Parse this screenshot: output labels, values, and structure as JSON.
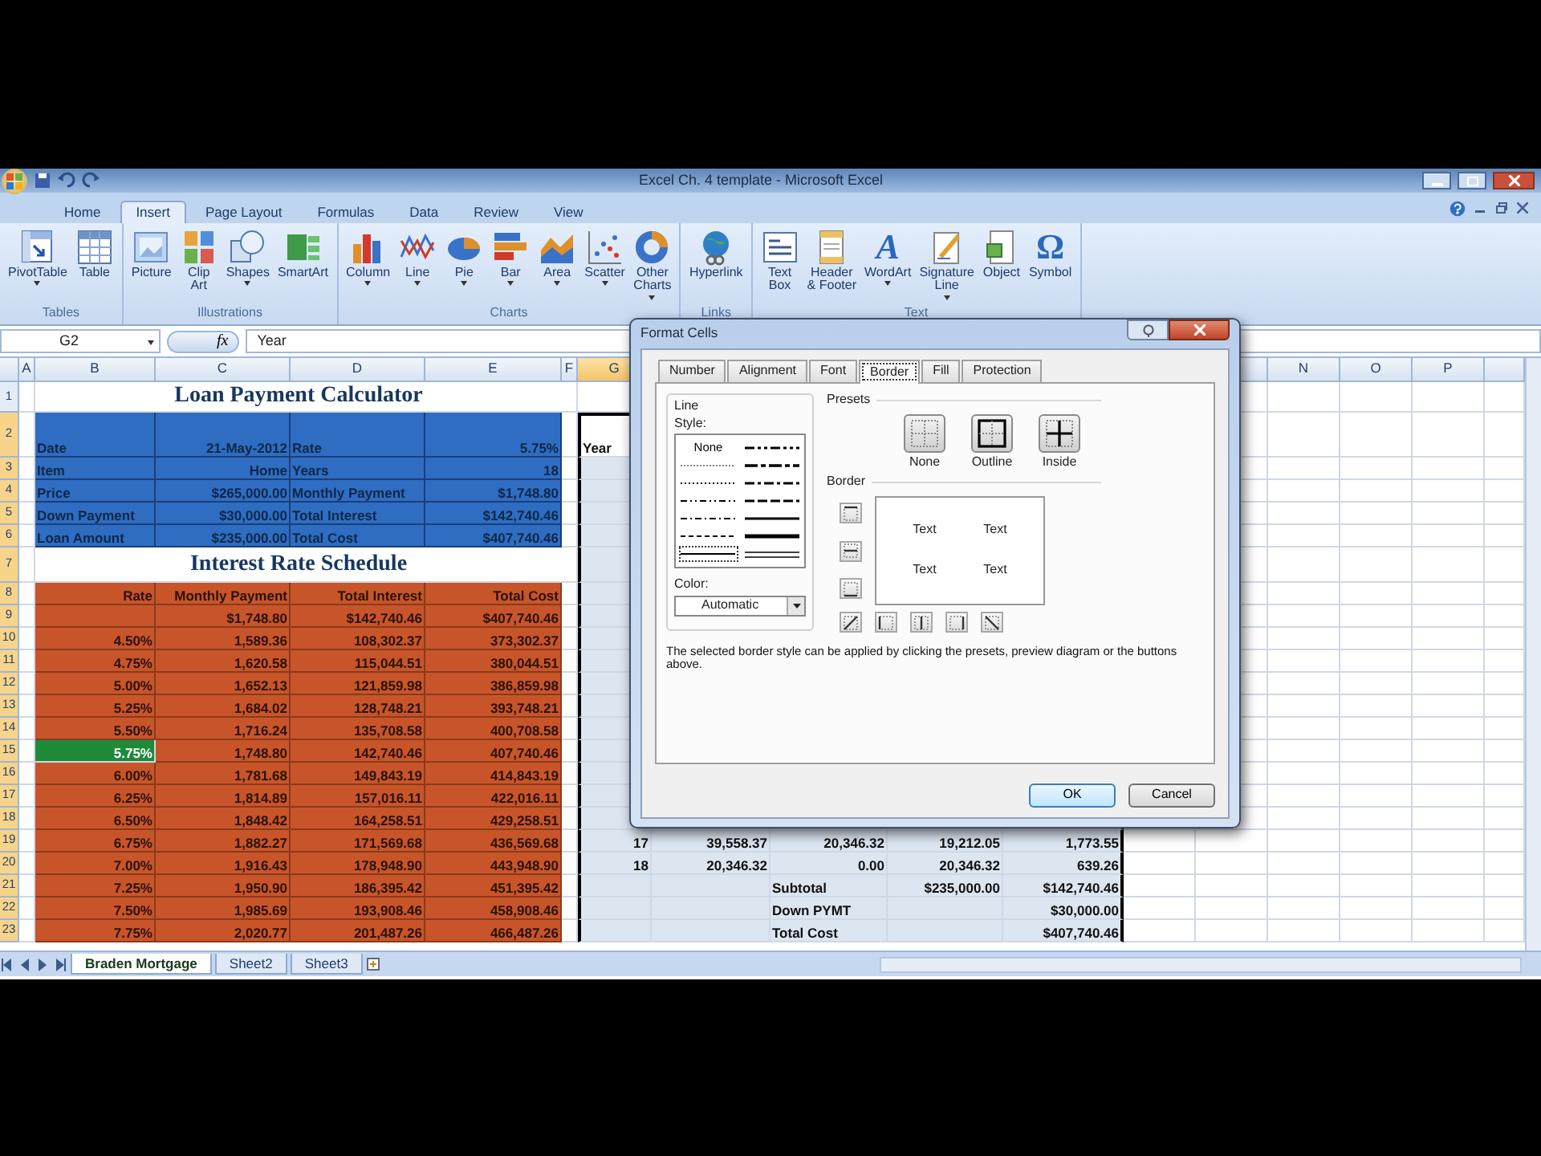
{
  "window": {
    "title": "Excel Ch. 4 template - Microsoft Excel"
  },
  "ribbon_tabs": [
    {
      "label": "Home",
      "selected": false
    },
    {
      "label": "Insert",
      "selected": true
    },
    {
      "label": "Page Layout",
      "selected": false
    },
    {
      "label": "Formulas",
      "selected": false
    },
    {
      "label": "Data",
      "selected": false
    },
    {
      "label": "Review",
      "selected": false
    },
    {
      "label": "View",
      "selected": false
    }
  ],
  "ribbon_groups": [
    {
      "label": "Tables",
      "buttons": [
        {
          "kind": "pivottable",
          "label": "PivotTable",
          "dropdown": true
        },
        {
          "kind": "table",
          "label": "Table",
          "dropdown": false
        }
      ]
    },
    {
      "label": "Illustrations",
      "buttons": [
        {
          "kind": "picture",
          "label": "Picture",
          "dropdown": false
        },
        {
          "kind": "clipart",
          "label": "Clip\nArt",
          "dropdown": false
        },
        {
          "kind": "shapes",
          "label": "Shapes",
          "dropdown": true
        },
        {
          "kind": "smartart",
          "label": "SmartArt",
          "dropdown": false
        }
      ]
    },
    {
      "label": "Charts",
      "buttons": [
        {
          "kind": "column",
          "label": "Column",
          "dropdown": true
        },
        {
          "kind": "line",
          "label": "Line",
          "dropdown": true
        },
        {
          "kind": "pie",
          "label": "Pie",
          "dropdown": true
        },
        {
          "kind": "bar",
          "label": "Bar",
          "dropdown": true
        },
        {
          "kind": "area",
          "label": "Area",
          "dropdown": true
        },
        {
          "kind": "scatter",
          "label": "Scatter",
          "dropdown": true
        },
        {
          "kind": "other-charts",
          "label": "Other\nCharts",
          "dropdown": true
        }
      ]
    },
    {
      "label": "Links",
      "buttons": [
        {
          "kind": "hyperlink",
          "label": "Hyperlink",
          "dropdown": false
        }
      ]
    },
    {
      "label": "Text",
      "buttons": [
        {
          "kind": "textbox",
          "label": "Text\nBox",
          "dropdown": false
        },
        {
          "kind": "header-footer",
          "label": "Header\n& Footer",
          "dropdown": false
        },
        {
          "kind": "wordart",
          "glyph": "A",
          "label": "WordArt",
          "dropdown": true
        },
        {
          "kind": "signature",
          "label": "Signature\nLine",
          "dropdown": true
        },
        {
          "kind": "object",
          "label": "Object",
          "dropdown": false
        },
        {
          "kind": "symbol",
          "glyph": "Ω",
          "label": "Symbol",
          "dropdown": false
        }
      ]
    }
  ],
  "formula_bar": {
    "name_box": "G2",
    "function_label": "fx",
    "formula": "Year"
  },
  "column_headers_left": [
    {
      "label": "A",
      "selected": false
    },
    {
      "label": "B",
      "selected": false
    },
    {
      "label": "C",
      "selected": false
    },
    {
      "label": "D",
      "selected": false
    },
    {
      "label": "E",
      "selected": false
    },
    {
      "label": "F",
      "selected": false
    },
    {
      "label": "G",
      "selected": true
    }
  ],
  "column_headers_right": [
    {
      "label": "N",
      "selected": false
    },
    {
      "label": "O",
      "selected": false
    },
    {
      "label": "P",
      "selected": false
    }
  ],
  "row_headers": [
    {
      "label": "1",
      "selected": false
    },
    {
      "label": "2",
      "selected": true
    },
    {
      "label": "3",
      "selected": true
    },
    {
      "label": "4",
      "selected": true
    },
    {
      "label": "5",
      "selected": true
    },
    {
      "label": "6",
      "selected": true
    },
    {
      "label": "7",
      "selected": true
    },
    {
      "label": "8",
      "selected": true
    },
    {
      "label": "9",
      "selected": true
    },
    {
      "label": "10",
      "selected": true
    },
    {
      "label": "11",
      "selected": true
    },
    {
      "label": "12",
      "selected": true
    },
    {
      "label": "13",
      "selected": true
    },
    {
      "label": "14",
      "selected": true
    },
    {
      "label": "15",
      "selected": true
    },
    {
      "label": "16",
      "selected": true
    },
    {
      "label": "17",
      "selected": true
    },
    {
      "label": "18",
      "selected": true
    },
    {
      "label": "19",
      "selected": true
    },
    {
      "label": "20",
      "selected": true
    },
    {
      "label": "21",
      "selected": true
    },
    {
      "label": "22",
      "selected": true
    },
    {
      "label": "23",
      "selected": true
    }
  ],
  "loan_calculator": {
    "title": "Loan Payment Calculator",
    "rows": [
      {
        "label": "Date",
        "value": "21-May-2012",
        "label_2": "Rate",
        "value_2": "5.75%"
      },
      {
        "label": "Item",
        "value": "Home",
        "label_2": "Years",
        "value_2": "18"
      },
      {
        "label": "Price",
        "value": "$265,000.00",
        "label_2": "Monthly Payment",
        "value_2": "$1,748.80"
      },
      {
        "label": "Down Payment",
        "value": "$30,000.00",
        "label_2": "Total Interest",
        "value_2": "$142,740.46"
      },
      {
        "label": "Loan Amount",
        "value": "$235,000.00",
        "label_2": "Total Cost",
        "value_2": "$407,740.46"
      }
    ]
  },
  "rate_schedule": {
    "title": "Interest Rate Schedule",
    "columns": [
      "Rate",
      "Monthly Payment",
      "Total Interest",
      "Total Cost"
    ],
    "rows": [
      {
        "cells": [
          null,
          "$1,748.80",
          "$142,740.46",
          "$407,740.46"
        ],
        "highlighted": false
      },
      {
        "cells": [
          "4.50%",
          "1,589.36",
          "108,302.37",
          "373,302.37"
        ],
        "highlighted": false
      },
      {
        "cells": [
          "4.75%",
          "1,620.58",
          "115,044.51",
          "380,044.51"
        ],
        "highlighted": false
      },
      {
        "cells": [
          "5.00%",
          "1,652.13",
          "121,859.98",
          "386,859.98"
        ],
        "highlighted": false
      },
      {
        "cells": [
          "5.25%",
          "1,684.02",
          "128,748.21",
          "393,748.21"
        ],
        "highlighted": false
      },
      {
        "cells": [
          "5.50%",
          "1,716.24",
          "135,708.58",
          "400,708.58"
        ],
        "highlighted": false
      },
      {
        "cells": [
          "5.75%",
          "1,748.80",
          "142,740.46",
          "407,740.46"
        ],
        "highlighted": true
      },
      {
        "cells": [
          "6.00%",
          "1,781.68",
          "149,843.19",
          "414,843.19"
        ],
        "highlighted": false
      },
      {
        "cells": [
          "6.25%",
          "1,814.89",
          "157,016.11",
          "422,016.11"
        ],
        "highlighted": false
      },
      {
        "cells": [
          "6.50%",
          "1,848.42",
          "164,258.51",
          "429,258.51"
        ],
        "highlighted": false
      },
      {
        "cells": [
          "6.75%",
          "1,882.27",
          "171,569.68",
          "436,569.68"
        ],
        "highlighted": false
      },
      {
        "cells": [
          "7.00%",
          "1,916.43",
          "178,948.90",
          "443,948.90"
        ],
        "highlighted": false
      },
      {
        "cells": [
          "7.25%",
          "1,950.90",
          "186,395.42",
          "451,395.42"
        ],
        "highlighted": false
      },
      {
        "cells": [
          "7.50%",
          "1,985.69",
          "193,908.46",
          "458,908.46"
        ],
        "highlighted": false
      },
      {
        "cells": [
          "7.75%",
          "2,020.77",
          "201,487.26",
          "466,487.26"
        ],
        "highlighted": false
      }
    ]
  },
  "year_table": {
    "header": "Year",
    "rows": [
      {
        "cells": [
          "17",
          "39,558.37",
          "20,346.32",
          "19,212.05",
          "1,773.55"
        ]
      },
      {
        "cells": [
          "18",
          "20,346.32",
          "0.00",
          "20,346.32",
          "639.26"
        ]
      }
    ],
    "summary": [
      {
        "label": "Subtotal",
        "column_4": "$235,000.00",
        "column_5": "$142,740.46"
      },
      {
        "label": "Down PYMT",
        "column_5": "$30,000.00"
      },
      {
        "label": "Total Cost",
        "column_5": "$407,740.46"
      }
    ]
  },
  "dialog": {
    "title": "Format Cells",
    "tabs": [
      {
        "label": "Number",
        "selected": false
      },
      {
        "label": "Alignment",
        "selected": false
      },
      {
        "label": "Font",
        "selected": false
      },
      {
        "label": "Border",
        "selected": true
      },
      {
        "label": "Fill",
        "selected": false
      },
      {
        "label": "Protection",
        "selected": false
      }
    ],
    "line": {
      "legend": "Line",
      "style_label": "Style:",
      "styles": [
        {
          "kind": "none",
          "label": "None",
          "selected": false
        },
        {
          "kind": "mdashdotdot",
          "selected": false
        },
        {
          "kind": "hair",
          "selected": false
        },
        {
          "kind": "slantdashdot",
          "selected": false
        },
        {
          "kind": "dotted",
          "selected": false
        },
        {
          "kind": "mdashdot",
          "selected": false
        },
        {
          "kind": "dashdotdot",
          "selected": false
        },
        {
          "kind": "mdashed",
          "selected": false
        },
        {
          "kind": "dashdot",
          "selected": false
        },
        {
          "kind": "medium",
          "selected": false
        },
        {
          "kind": "dashed",
          "selected": false
        },
        {
          "kind": "thick",
          "selected": false
        },
        {
          "kind": "thin",
          "selected": true
        },
        {
          "kind": "double",
          "selected": false
        }
      ],
      "color_label": "Color:",
      "color_value": "Automatic"
    },
    "presets": {
      "legend": "Presets",
      "items": [
        {
          "kind": "none",
          "label": "None"
        },
        {
          "kind": "outline",
          "label": "Outline"
        },
        {
          "kind": "inside",
          "label": "Inside"
        }
      ]
    },
    "border": {
      "legend": "Border",
      "preview_texts": [
        "Text",
        "Text",
        "Text",
        "Text"
      ],
      "buttons": [
        {
          "kind": "top"
        },
        {
          "kind": "middle"
        },
        {
          "kind": "bottom"
        },
        {
          "kind": "diag-up"
        },
        {
          "kind": "left"
        },
        {
          "kind": "center"
        },
        {
          "kind": "right"
        },
        {
          "kind": "diag-down"
        }
      ]
    },
    "note": "The selected border style can be applied by clicking the presets, preview diagram or the buttons above.",
    "buttons": [
      "OK",
      "Cancel"
    ]
  },
  "sheet_tabs": [
    {
      "label": "Braden Mortgage",
      "selected": true
    },
    {
      "label": "Sheet2",
      "selected": false
    },
    {
      "label": "Sheet3",
      "selected": false
    }
  ]
}
